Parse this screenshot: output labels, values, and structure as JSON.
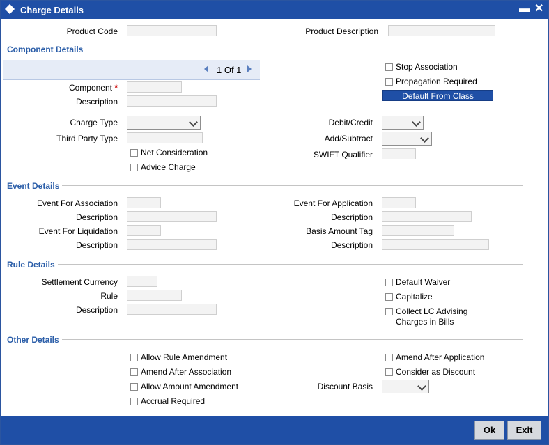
{
  "window": {
    "title": "Charge Details",
    "minimize": "▬",
    "close": "✕"
  },
  "header": {
    "product_code_label": "Product Code",
    "product_description_label": "Product Description"
  },
  "component": {
    "section_title": "Component Details",
    "pager_text": "1 Of 1",
    "component_label": "Component",
    "required_mark": "*",
    "description_label": "Description",
    "charge_type_label": "Charge Type",
    "third_party_type_label": "Third Party Type",
    "net_consideration_label": "Net Consideration",
    "advice_charge_label": "Advice Charge",
    "stop_association_label": "Stop Association",
    "propagation_required_label": "Propagation Required",
    "default_from_class_label": "Default From Class",
    "debit_credit_label": "Debit/Credit",
    "add_subtract_label": "Add/Subtract",
    "swift_qualifier_label": "SWIFT Qualifier"
  },
  "event": {
    "section_title": "Event Details",
    "event_for_association_label": "Event For Association",
    "description_label": "Description",
    "event_for_liquidation_label": "Event For Liquidation",
    "event_for_application_label": "Event For Application",
    "basis_amount_tag_label": "Basis Amount Tag"
  },
  "rule": {
    "section_title": "Rule Details",
    "settlement_currency_label": "Settlement Currency",
    "rule_label": "Rule",
    "description_label": "Description",
    "default_waiver_label": "Default Waiver",
    "capitalize_label": "Capitalize",
    "collect_lc_line1": "Collect LC Advising",
    "collect_lc_line2": "Charges in Bills"
  },
  "other": {
    "section_title": "Other Details",
    "allow_rule_amendment_label": "Allow Rule Amendment",
    "amend_after_association_label": "Amend After Association",
    "allow_amount_amendment_label": "Allow Amount Amendment",
    "accrual_required_label": "Accrual Required",
    "amend_after_application_label": "Amend After Application",
    "consider_as_discount_label": "Consider as Discount",
    "discount_basis_label": "Discount Basis"
  },
  "footer": {
    "ok_label": "Ok",
    "exit_label": "Exit"
  },
  "colors": {
    "titlebar": "#1f4fa6",
    "section_title": "#2a5da8",
    "button": "#1f4fa6"
  }
}
